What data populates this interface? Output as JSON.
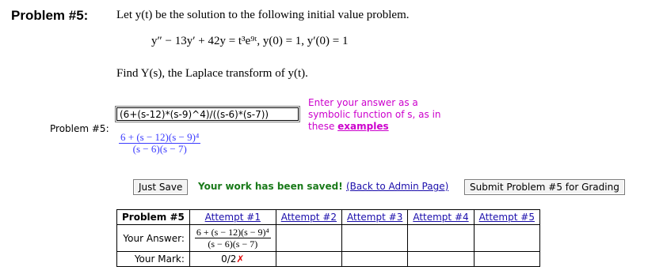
{
  "problem": {
    "heading": "Problem #5:",
    "intro": "Let y(t) be the solution to the following initial value problem.",
    "equation": "y″ − 13y′ + 42y = t³e⁹ᵗ,   y(0) = 1,  y′(0) = 1",
    "task": "Find Y(s), the Laplace transform of y(t)."
  },
  "answer": {
    "row_label": "Problem #5:",
    "input_value": "(6+(s-12)*(s-9)^4)/((s-6)*(s-7))",
    "preview_num": "6 + (s − 12)(s − 9)⁴",
    "preview_den": "(s − 6)(s − 7)",
    "hint_lines": [
      "Enter your answer as a",
      "symbolic function of s, as in",
      "these"
    ],
    "hint_link": "examples"
  },
  "actions": {
    "just_save": "Just Save",
    "saved_msg": "Your work has been saved!",
    "admin_link": "(Back to Admin Page)",
    "submit": "Submit Problem #5 for Grading"
  },
  "attempts": {
    "header": "Problem #5",
    "columns": [
      "Attempt #1",
      "Attempt #2",
      "Attempt #3",
      "Attempt #4",
      "Attempt #5"
    ],
    "your_answer_label": "Your Answer:",
    "your_mark_label": "Your Mark:",
    "attempt1_num": "6 + (s − 12)(s − 9)⁴",
    "attempt1_den": "(s − 6)(s − 7)",
    "attempt1_mark": "0/2",
    "attempt1_mark_symbol": "✗"
  }
}
